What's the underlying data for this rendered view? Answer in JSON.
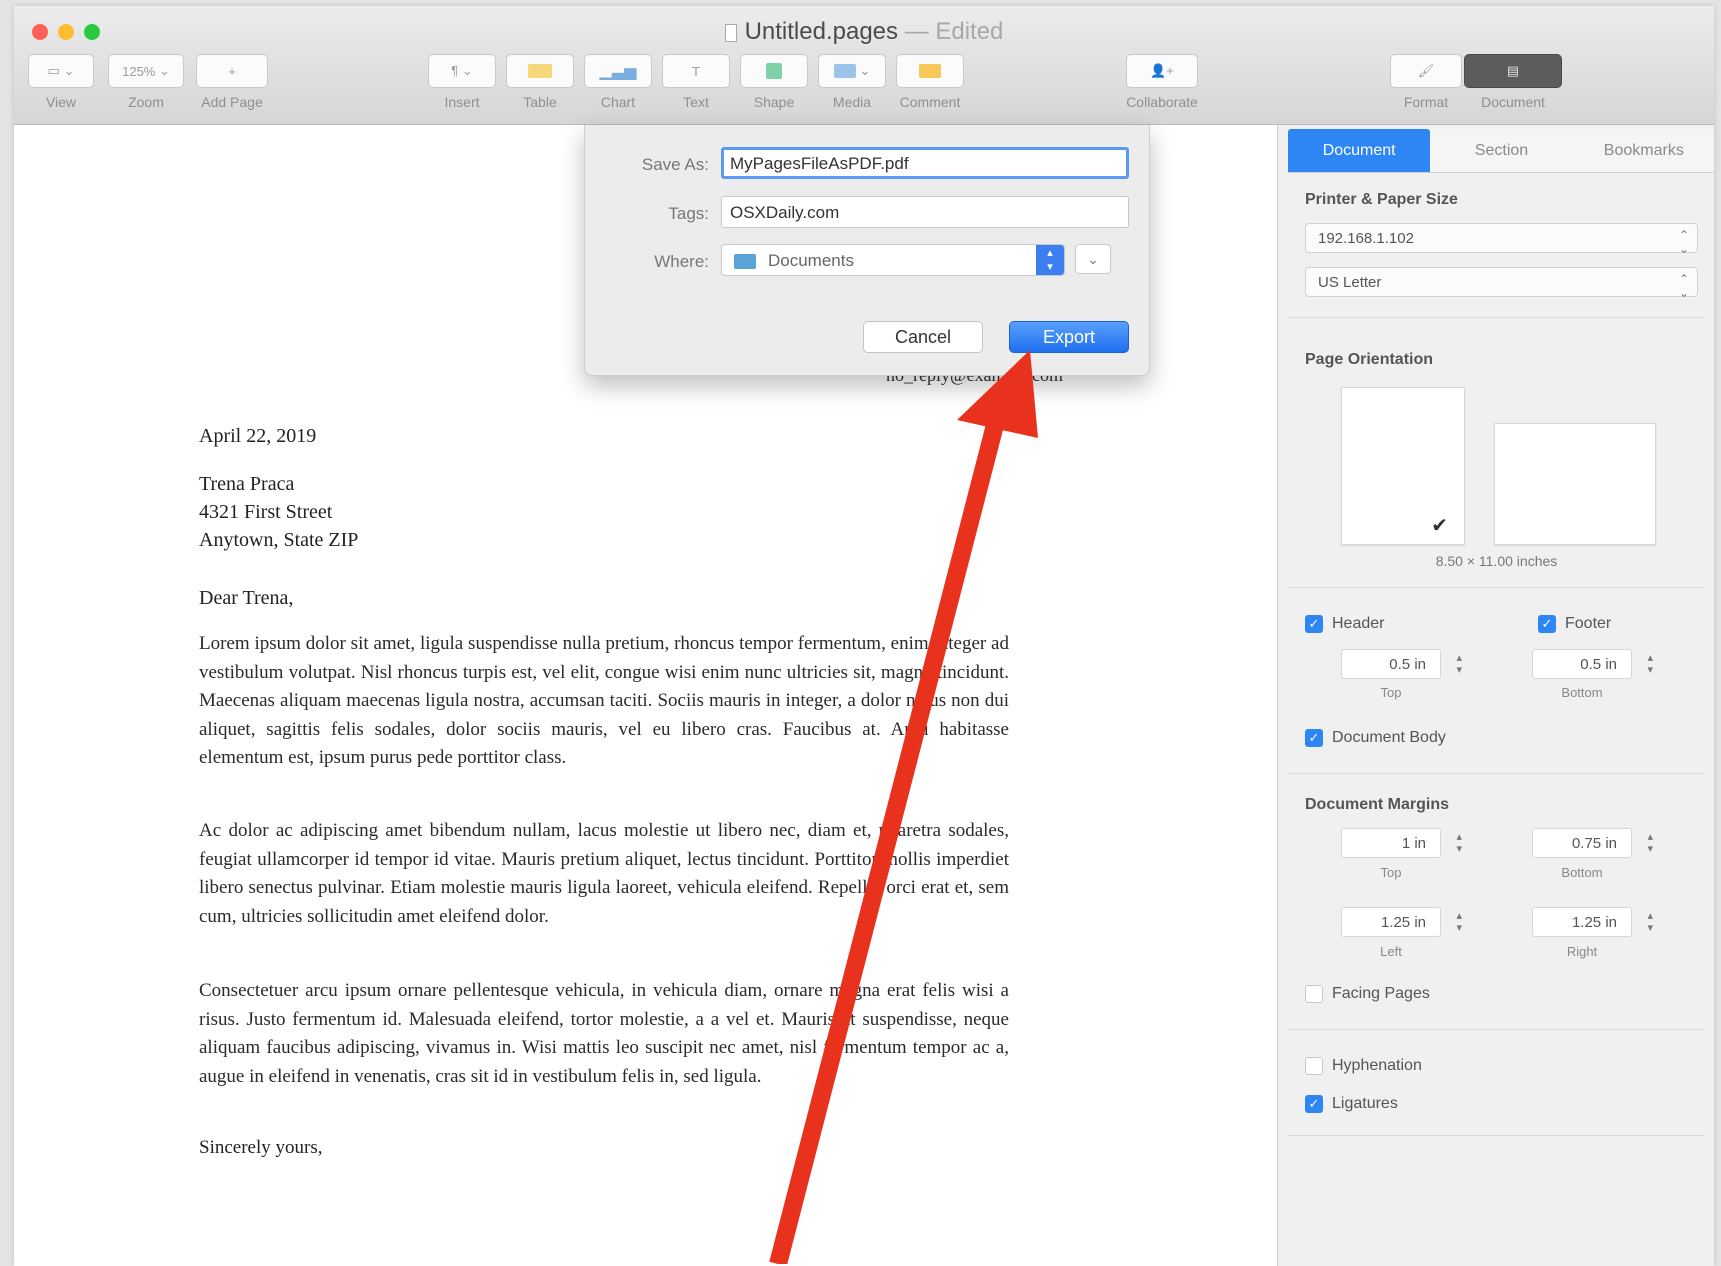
{
  "window": {
    "title": "Untitled.pages",
    "title_status": "— Edited"
  },
  "toolbar": {
    "items": [
      {
        "label": "View",
        "icon": "view-icon"
      },
      {
        "label": "Zoom",
        "value": "125%"
      },
      {
        "label": "Add Page",
        "icon": "plus-icon"
      },
      {
        "label": "Insert",
        "icon": "paragraph-icon"
      },
      {
        "label": "Table",
        "icon": "table-icon"
      },
      {
        "label": "Chart",
        "icon": "chart-icon"
      },
      {
        "label": "Text",
        "icon": "text-icon"
      },
      {
        "label": "Shape",
        "icon": "shape-icon"
      },
      {
        "label": "Media",
        "icon": "media-icon"
      },
      {
        "label": "Comment",
        "icon": "comment-icon"
      },
      {
        "label": "Collaborate",
        "icon": "collaborate-icon"
      },
      {
        "label": "Format",
        "icon": "format-icon"
      },
      {
        "label": "Document",
        "icon": "document-icon"
      }
    ]
  },
  "export_sheet": {
    "save_as_label": "Save As:",
    "save_as_value": "MyPagesFileAsPDF.pdf",
    "tags_label": "Tags:",
    "tags_value": "OSXDaily.com",
    "where_label": "Where:",
    "where_value": "Documents",
    "cancel_label": "Cancel",
    "export_label": "Export"
  },
  "letter": {
    "sender_email": "no_reply@example.com",
    "date": "April 22, 2019",
    "recipient_name": "Trena Praca",
    "recipient_street": "4321 First Street",
    "recipient_city": "Anytown, State ZIP",
    "greeting": "Dear Trena,",
    "paragraph_1": "Lorem ipsum dolor sit amet, ligula suspendisse nulla pretium, rhoncus tempor fermentum, enim integer ad vestibulum volutpat. Nisl rhoncus turpis est, vel elit, congue wisi enim nunc ultricies sit, magna tincidunt. Maecenas aliquam maecenas ligula nostra, accumsan taciti. Sociis mauris in integer, a dolor netus non dui aliquet, sagittis felis sodales, dolor sociis mauris, vel eu libero cras. Faucibus at. Arcu habitasse elementum est, ipsum purus pede porttitor class.",
    "paragraph_2": "Ac dolor ac adipiscing amet bibendum nullam, lacus molestie ut libero nec, diam et, pharetra sodales, feugiat ullamcorper id tempor id vitae. Mauris pretium aliquet, lectus tincidunt. Porttitor mollis imperdiet libero senectus pulvinar. Etiam molestie mauris ligula laoreet, vehicula eleifend. Repellat orci erat et, sem cum, ultricies sollicitudin amet eleifend dolor.",
    "paragraph_3": "Consectetuer arcu ipsum ornare pellentesque vehicula, in vehicula diam, ornare magna erat felis wisi a risus. Justo fermentum id. Malesuada eleifend, tortor molestie, a a vel et. Mauris at suspendisse, neque aliquam faucibus adipiscing, vivamus in. Wisi mattis leo suscipit nec amet, nisl fermentum tempor ac a, augue in eleifend in venenatis, cras sit id in vestibulum felis in, sed ligula.",
    "closing": "Sincerely yours,"
  },
  "inspector": {
    "tabs": [
      "Document",
      "Section",
      "Bookmarks"
    ],
    "printer_paper_title": "Printer & Paper Size",
    "printer": "192.168.1.102",
    "paper": "US Letter",
    "orientation_title": "Page Orientation",
    "page_dimensions": "8.50 × 11.00 inches",
    "header_label": "Header",
    "footer_label": "Footer",
    "header_value": "0.5 in",
    "footer_value": "0.5 in",
    "top_label": "Top",
    "bottom_label": "Bottom",
    "document_body_label": "Document Body",
    "margins_title": "Document Margins",
    "margin_top": "1 in",
    "margin_bottom": "0.75 in",
    "margin_left": "1.25 in",
    "margin_right": "1.25 in",
    "left_label": "Left",
    "right_label": "Right",
    "facing_pages_label": "Facing Pages",
    "hyphenation_label": "Hyphenation",
    "ligatures_label": "Ligatures",
    "header_checked": true,
    "footer_checked": true,
    "document_body_checked": true,
    "facing_pages_checked": false,
    "hyphenation_checked": false,
    "ligatures_checked": true
  },
  "colors": {
    "accent": "#2d86f3",
    "annotation_arrow": "#e8321e"
  }
}
